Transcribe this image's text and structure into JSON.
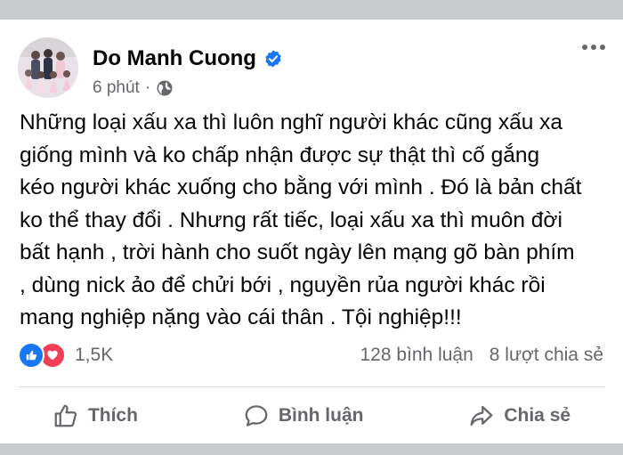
{
  "post": {
    "author": "Do Manh Cuong",
    "time": "6 phút",
    "separator": "·",
    "text": "Những loại xấu xa thì luôn nghĩ người khác cũng xấu xa\ngiống mình và ko chấp nhận được sự thật thì cố gắng\nkéo người khác xuống cho bằng với mình . Đó là bản chất\nko thể thay đổi . Nhưng rất tiếc, loại xấu xa thì muôn đời\nbất hạnh , trời hành cho suốt ngày lên mạng gõ bàn phím\n, dùng nick ảo để  chửi bới , nguyền rủa người khác rồi\nmang nghiệp nặng vào cái thân . Tội nghiệp!!!"
  },
  "reactions": {
    "count": "1,5K",
    "comments": "128 bình luận",
    "shares": "8 lượt chia sẻ"
  },
  "actions": {
    "like": "Thích",
    "comment": "Bình luận",
    "share": "Chia sẻ"
  },
  "colors": {
    "brand_blue": "#1877f2",
    "love_red": "#f33e58",
    "secondary_text": "#65676b"
  }
}
